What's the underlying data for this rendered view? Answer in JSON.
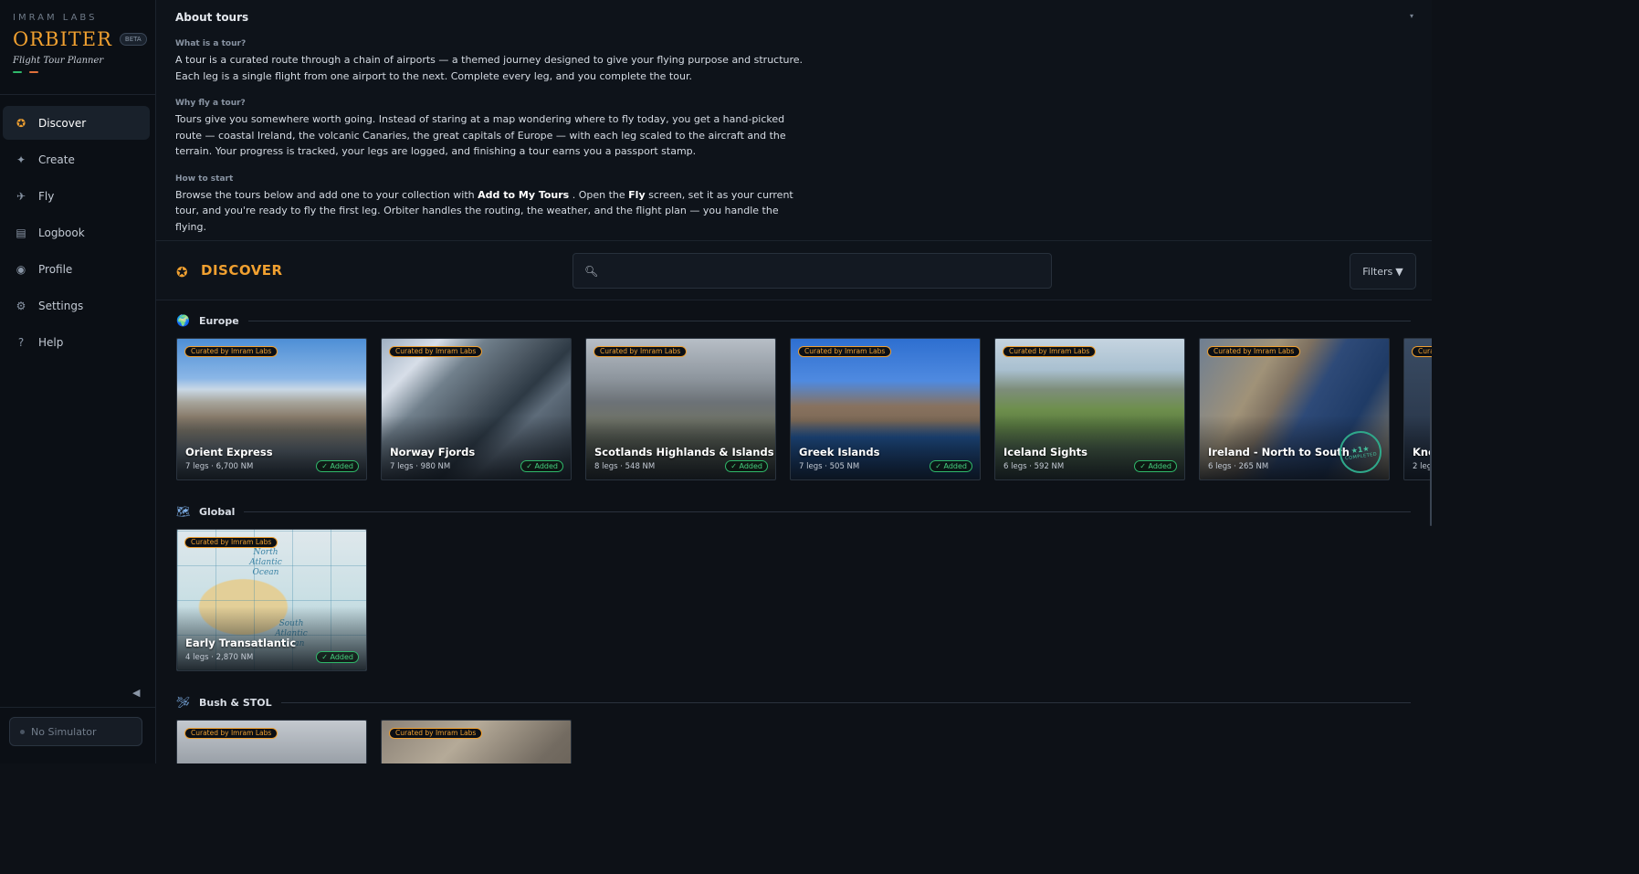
{
  "brand": {
    "company": "IMRAM LABS",
    "name": "ORBITER",
    "beta": "BETA",
    "tagline": "Flight Tour Planner",
    "accent": "#f0a030",
    "dash_colors": [
      "#2fb86a",
      "#e0703a"
    ]
  },
  "nav": [
    {
      "label": "Discover",
      "icon": "compass-icon",
      "glyph": "✪",
      "active": true
    },
    {
      "label": "Create",
      "icon": "sparkle-icon",
      "glyph": "✦",
      "active": false
    },
    {
      "label": "Fly",
      "icon": "airplane-icon",
      "glyph": "✈",
      "active": false
    },
    {
      "label": "Logbook",
      "icon": "logbook-icon",
      "glyph": "▤",
      "active": false
    },
    {
      "label": "Profile",
      "icon": "profile-icon",
      "glyph": "◉",
      "active": false
    },
    {
      "label": "Settings",
      "icon": "gear-icon",
      "glyph": "⚙",
      "active": false
    },
    {
      "label": "Help",
      "icon": "help-icon",
      "glyph": "?",
      "active": false
    }
  ],
  "sidebar_footer": {
    "collapse_glyph": "◀",
    "simulator_status": "No Simulator"
  },
  "about": {
    "title": "About tours",
    "chevron": "▾",
    "q1": "What is a tour?",
    "p1": "A tour is a curated route through a chain of airports — a themed journey designed to give your flying purpose and structure. Each leg is a single flight from one airport to the next. Complete every leg, and you complete the tour.",
    "q2": "Why fly a tour?",
    "p2": "Tours give you somewhere worth going. Instead of staring at a map wondering where to fly today, you get a hand-picked route — coastal Ireland, the volcanic Canaries, the great capitals of Europe — with each leg scaled to the aircraft and the terrain. Your progress is tracked, your legs are logged, and finishing a tour earns you a passport stamp.",
    "q3": "How to start",
    "p3_a": "Browse the tours below and add one to your collection with ",
    "p3_b": "Add to My Tours",
    "p3_c": " . Open the ",
    "p3_d": "Fly",
    "p3_e": " screen, set it as your current tour, and you're ready to fly the first leg. Orbiter handles the routing, the weather, and the flight plan — you handle the flying."
  },
  "discover": {
    "title": "DISCOVER",
    "search_value": "",
    "search_placeholder": "",
    "filters_label": "Filters",
    "filters_glyph": "▼"
  },
  "sections": [
    {
      "title": "Europe",
      "icon": "globe-icon",
      "glyph": "🌍",
      "cards": [
        {
          "title": "Orient Express",
          "meta": "7  legs ·  6,700  NM",
          "curated": "Curated by Imram Labs",
          "added": "✓ Added",
          "bg": "bg-orient"
        },
        {
          "title": "Norway Fjords",
          "meta": "7  legs ·  980  NM",
          "curated": "Curated by Imram Labs",
          "added": "✓ Added",
          "bg": "bg-norway"
        },
        {
          "title": "Scotlands Highlands & Islands",
          "meta": "8  legs ·  548  NM",
          "curated": "Curated by Imram Labs",
          "added": "✓ Added",
          "bg": "bg-scot"
        },
        {
          "title": "Greek Islands",
          "meta": "7  legs ·  505  NM",
          "curated": "Curated by Imram Labs",
          "added": "✓ Added",
          "bg": "bg-greek"
        },
        {
          "title": "Iceland Sights",
          "meta": "6  legs ·  592  NM",
          "curated": "Curated by Imram Labs",
          "added": "✓ Added",
          "bg": "bg-iceland"
        },
        {
          "title": "Ireland - North to South",
          "meta": "6  legs ·  265  NM",
          "curated": "Curated by Imram Labs",
          "added": "",
          "stamp_count": "★1★",
          "stamp_label": "COMPLETED",
          "bg": "bg-ireland"
        },
        {
          "title": "Kno",
          "meta": "2  leg",
          "curated": "Cura",
          "added": "",
          "bg": "bg-knock"
        }
      ]
    },
    {
      "title": "Global",
      "icon": "world-map-icon",
      "glyph": "🗺",
      "cards": [
        {
          "title": "Early Transatlantic",
          "meta": "4  legs ·  2,870  NM",
          "curated": "Curated by Imram Labs",
          "added": "✓ Added",
          "bg": "bg-map",
          "map_labels": [
            "North Atlantic Ocean",
            "South Atlantic Ocean"
          ]
        }
      ]
    },
    {
      "title": "Bush & STOL",
      "icon": "bush-plane-icon",
      "glyph": "🛩",
      "cards": [
        {
          "title": "",
          "meta": "",
          "curated": "Curated by Imram Labs",
          "added": "",
          "bg": "bg-bush1"
        },
        {
          "title": "",
          "meta": "",
          "curated": "Curated by Imram Labs",
          "added": "",
          "bg": "bg-bush2"
        }
      ]
    }
  ]
}
